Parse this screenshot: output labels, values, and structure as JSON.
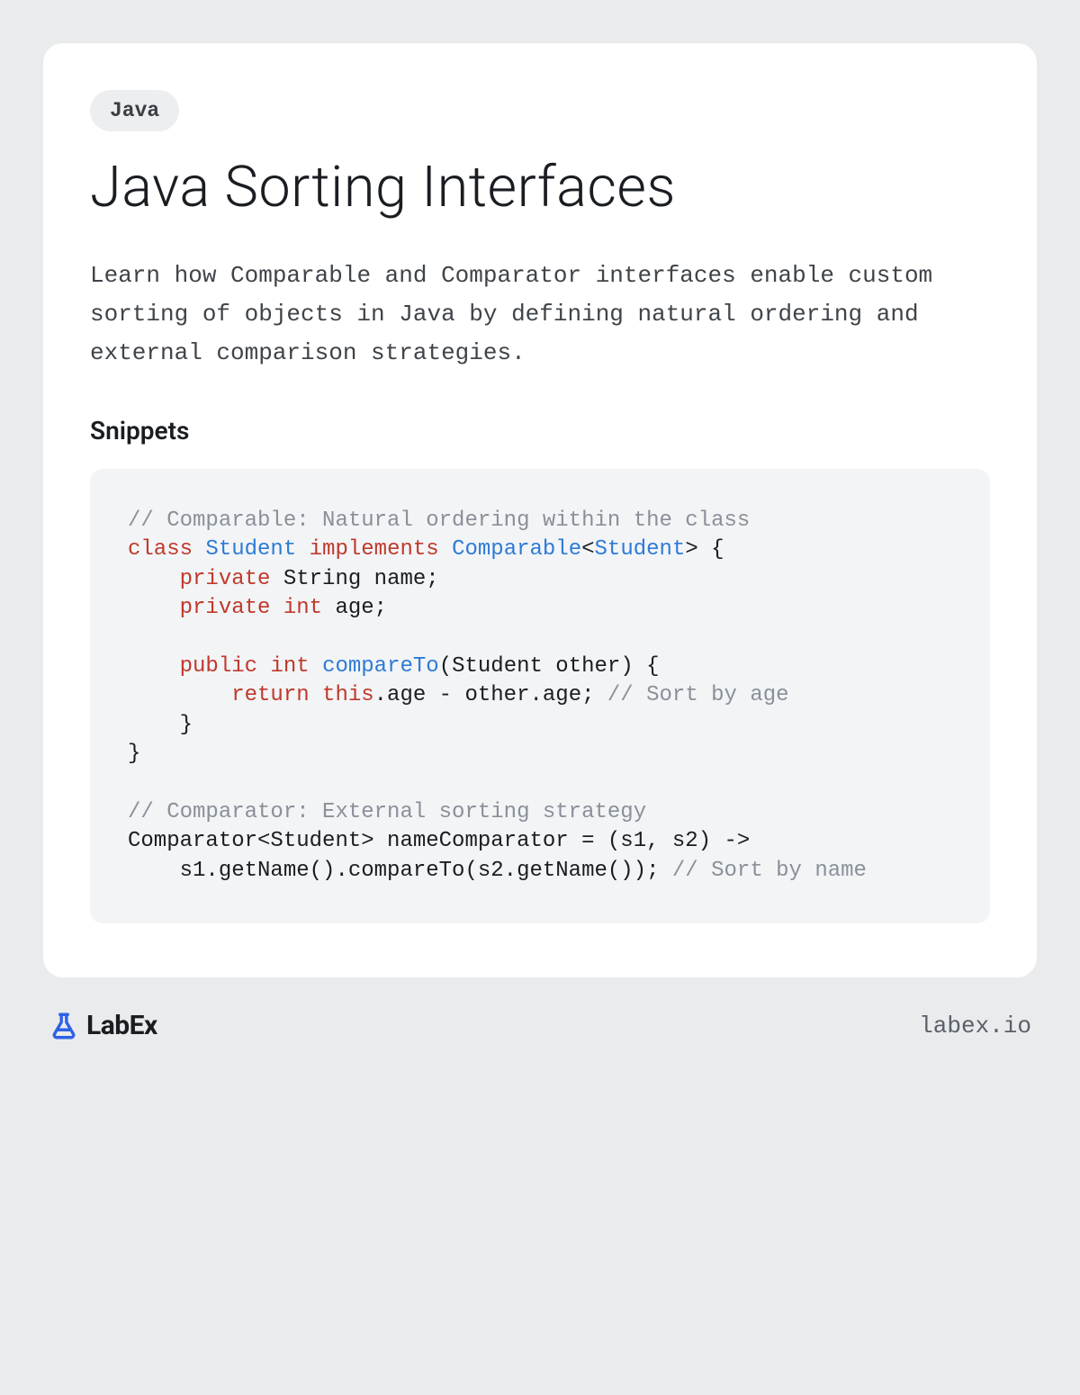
{
  "tag": "Java",
  "title": "Java Sorting Interfaces",
  "description": "Learn how Comparable and Comparator interfaces enable custom sorting of objects in Java by defining natural ordering and external comparison strategies.",
  "section_heading": "Snippets",
  "code": {
    "c1": "// Comparable: Natural ordering within the class",
    "kw_class": "class",
    "ty_student1": "Student",
    "kw_implements": "implements",
    "ty_comparable": "Comparable",
    "ty_student2": "Student",
    "brace_open": "> {",
    "kw_private1": "private",
    "ty_string": "String",
    "fld_name": " name;",
    "kw_private2": "private",
    "kw_int1": "int",
    "fld_age": " age;",
    "kw_public": "public",
    "kw_int2": "int",
    "fn_compareTo": "compareTo",
    "sig_rest": "(Student other) {",
    "kw_return": "return",
    "kw_this": "this",
    "ret_rest": ".age - other.age; ",
    "c2": "// Sort by age",
    "close_inner": "    }",
    "close_outer": "}",
    "c3": "// Comparator: External sorting strategy",
    "line_comp": "Comparator<Student> nameComparator = (s1, s2) ->",
    "line_body": "    s1.getName().compareTo(s2.getName()); ",
    "c4": "// Sort by name"
  },
  "footer": {
    "brand": "LabEx",
    "site": "labex.io"
  }
}
